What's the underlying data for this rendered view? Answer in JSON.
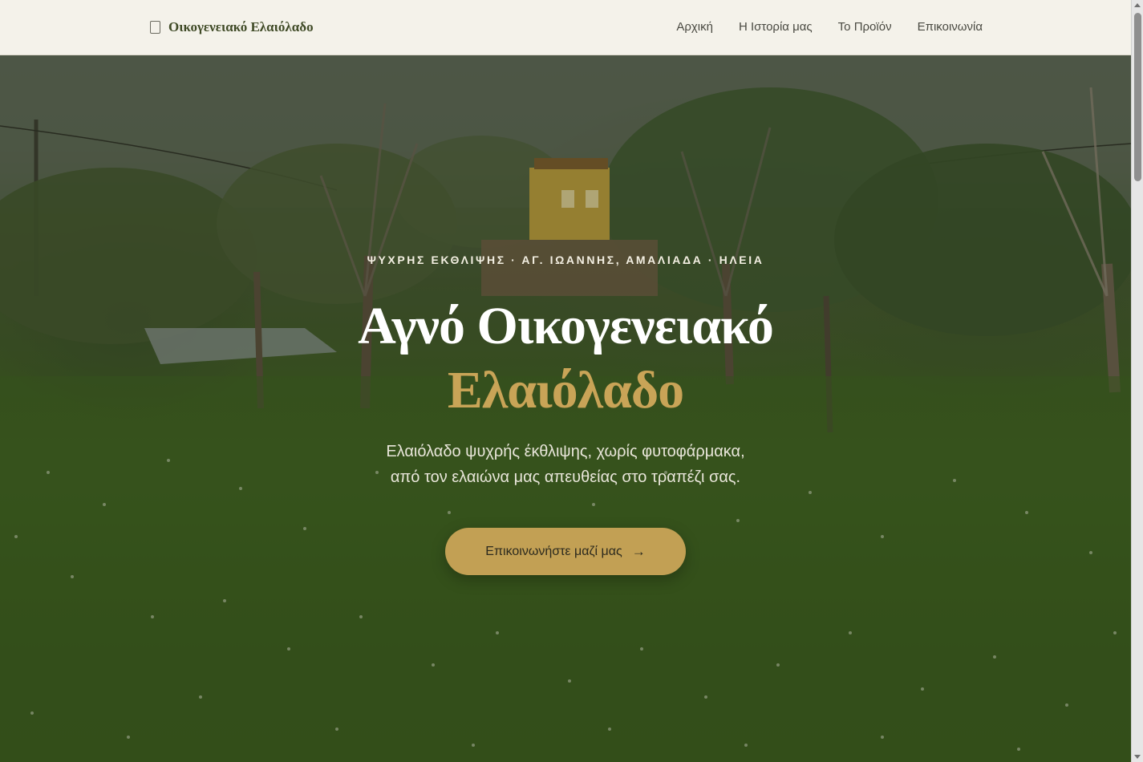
{
  "header": {
    "brand_name": "Οικογενειακό Ελαιόλαδο",
    "brand_icon": "square-outline-icon",
    "nav": [
      {
        "label": "Αρχική"
      },
      {
        "label": "Η Ιστορία μας"
      },
      {
        "label": "Το Προϊόν"
      },
      {
        "label": "Επικοινωνία"
      }
    ]
  },
  "hero": {
    "kicker": "ΨΥΧΡΗΣ ΕΚΘΛΙΨΗΣ · ΑΓ. ΙΩΑΝΝΗΣ, ΑΜΑΛΙΑΔΑ · ΗΛΕΙΑ",
    "title_line1": "Αγνό Οικογενειακό",
    "title_line2": "Ελαιόλαδο",
    "subtitle_line1": "Ελαιόλαδο ψυχρής έκθλιψης, χωρίς φυτοφάρμακα,",
    "subtitle_line2": "από τον ελαιώνα μας απευθείας στο τραπέζι σας.",
    "cta_label": "Επικοινωνήστε μαζί μας",
    "cta_icon": "arrow-right-icon"
  },
  "colors": {
    "header_bg": "#f4f2ea",
    "brand_text": "#3f4a26",
    "accent_gold": "#c9a457",
    "cta_bg": "#c2a054"
  }
}
